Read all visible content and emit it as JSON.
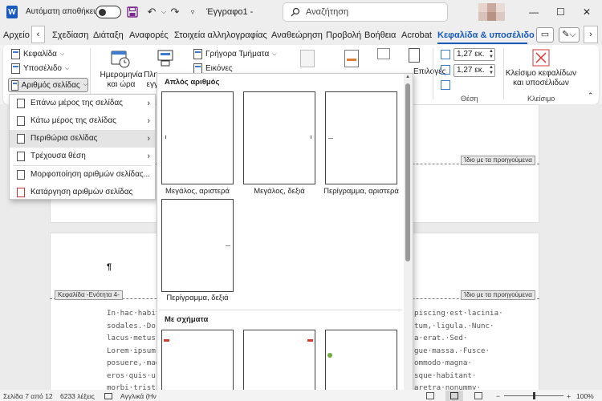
{
  "app": {
    "autosave_label": "Αυτόματη αποθήκευση",
    "doc_title": "Έγγραφο1 -",
    "search_placeholder": "Αναζήτηση"
  },
  "tabs": [
    "Αρχείο",
    "Σχεδίαση",
    "Διάταξη",
    "Αναφορές",
    "Στοιχεία αλληλογραφίας",
    "Αναθεώρηση",
    "Προβολή",
    "Βοήθεια",
    "Acrobat",
    "Κεφαλίδα & υποσέλιδο"
  ],
  "active_tab": "Κεφαλίδα & υποσέλιδο",
  "ribbon": {
    "header_btn": "Κεφαλίδα",
    "footer_btn": "Υποσέλιδο",
    "page_number_btn": "Αριθμός σελίδας",
    "date_time_line1": "Ημερομηνία",
    "date_time_line2": "και ώρα",
    "docinfo_line1": "Πλη",
    "docinfo_line2": "εγγ",
    "quick_parts": "Γρήγορα Τμήματα",
    "pictures": "Εικόνες",
    "options_partial": "Επιλογές",
    "header_pos": "1,27 εκ.",
    "footer_pos": "1,27 εκ.",
    "position_group": "Θέση",
    "close_label_line1": "Κλείσιμο κεφαλίδων",
    "close_label_line2": "και υποσέλιδων",
    "close_group": "Κλείσιμο"
  },
  "dropdown": {
    "items": [
      {
        "label": "Επάνω μέρος της σελίδας",
        "submenu": true
      },
      {
        "label": "Κάτω μέρος της σελίδας",
        "submenu": true
      },
      {
        "label": "Περιθώρια σελίδας",
        "submenu": true
      },
      {
        "label": "Τρέχουσα θέση",
        "submenu": true
      },
      {
        "label": "Μορφοποίηση αριθμών σελίδας...",
        "submenu": false
      },
      {
        "label": "Κατάργηση αριθμών σελίδας",
        "submenu": false
      }
    ],
    "highlighted_index": 2
  },
  "gallery": {
    "section1": "Απλός αριθμός",
    "section2": "Με σχήματα",
    "thumbnails": [
      "Μεγάλος, αριστερά",
      "Μεγάλος, δεξιά",
      "Περίγραμμα, αριστερά",
      "Περίγραμμα, δεξιά"
    ]
  },
  "document": {
    "same_as_previous_1": "Ίδιο με τα προηγούμενα",
    "same_as_previous_2": "Ίδιο με τα προηγούμενα",
    "header_section_tag": "Κεφαλίδα -Ενότητα 4-",
    "paragraph_mark": "¶",
    "lines_left": [
      "In·hac·habita",
      "sodales.·Dor",
      "lacus·metus,",
      "Lorem·ipsum",
      "posuere,·mag",
      "eros·quis·urr",
      "morbi·tristiqu"
    ],
    "lines_right": [
      "piscing·est·lacinia·",
      "tum,·ligula.·Nunc·",
      "a·erat.·Sed·",
      "gue·massa.·Fusce·",
      "ommodo·magna·",
      "sque·habitant·",
      "aretra·nonummy·"
    ]
  },
  "status": {
    "page": "Σελίδα 7 από 12",
    "words": "6233 λέξεις",
    "language": "Αγγλικά (Ην",
    "zoom": "100%"
  }
}
